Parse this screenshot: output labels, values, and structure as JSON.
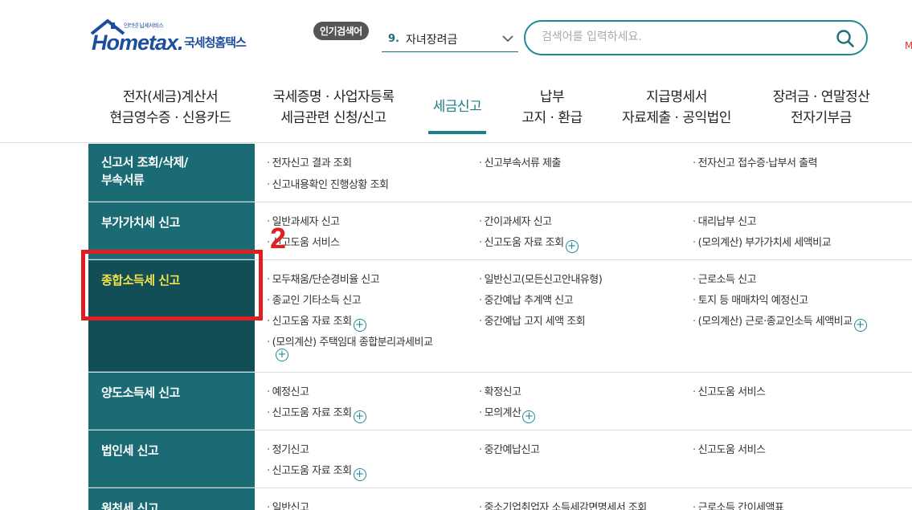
{
  "logo": {
    "tagline": "인터넷 납세서비스",
    "wordmark": "Hometax.",
    "korean_name": "국세청홈택스"
  },
  "header": {
    "popular_badge": "인기검색어",
    "popular_rank": "9.",
    "popular_term": "자녀장려금",
    "search_placeholder": "검색어를 입력하세요.",
    "edge_text": "M"
  },
  "nav": [
    {
      "line1": "전자(세금)계산서",
      "line2": "현금영수증 · 신용카드"
    },
    {
      "line1": "국세증명 · 사업자등록",
      "line2": "세금관련 신청/신고"
    },
    {
      "line1": "세금신고",
      "line2": ""
    },
    {
      "line1": "납부",
      "line2": "고지 · 환급"
    },
    {
      "line1": "지급명세서",
      "line2": "자료제출 · 공익법인"
    },
    {
      "line1": "장려금 · 연말정산",
      "line2": "전자기부금"
    }
  ],
  "menu": {
    "rows": [
      {
        "category": "신고서 조회/삭제/\n부속서류",
        "links": [
          "전자신고 결과 조회",
          "신고부속서류 제출",
          "전자신고 접수증·납부서 출력",
          "신고내용확인 진행상황 조회"
        ]
      },
      {
        "category": "부가가치세 신고",
        "links": [
          "일반과세자 신고",
          "간이과세자 신고",
          "대리납부 신고",
          "신고도움 서비스",
          "신고도움 자료 조회",
          "(모의계산) 부가가치세 세액비교"
        ]
      },
      {
        "category": "종합소득세 신고",
        "links": [
          "모두채움/단순경비율 신고",
          "일반신고(모든신고안내유형)",
          "근로소득 신고",
          "종교인 기타소득 신고",
          "중간예납 추계액 신고",
          "토지 등 매매차익 예정신고",
          "신고도움 자료 조회",
          "중간예납 고지 세액 조회",
          "(모의계산) 근로·종교인소득 세액비교",
          "(모의계산) 주택임대 종합분리과세비교"
        ]
      },
      {
        "category": "양도소득세 신고",
        "links": [
          "예정신고",
          "확정신고",
          "신고도움 서비스",
          "신고도움 자료 조회",
          "모의계산"
        ]
      },
      {
        "category": "법인세 신고",
        "links": [
          "정기신고",
          "중간예납신고",
          "신고도움 서비스",
          "신고도움 자료 조회"
        ]
      },
      {
        "category": "원천세 신고",
        "links": [
          "일반신고",
          "중소기업취업자 소득세감면명세서 조회",
          "근로소득 간이세액표"
        ]
      }
    ]
  },
  "annotation": {
    "number": "2"
  },
  "colors": {
    "accent": "#1c7f88",
    "category_bg": "#1b6b74",
    "category_active_bg": "#114e55",
    "highlight_text": "#f6e14b",
    "annotation": "#e02020"
  }
}
